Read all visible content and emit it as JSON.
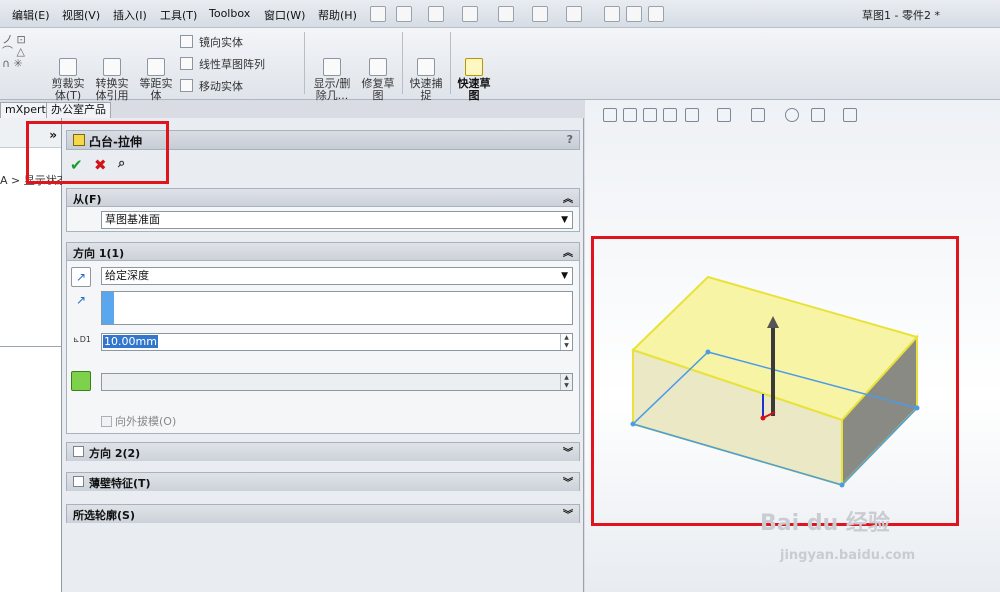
{
  "menubar": {
    "items": [
      "编辑(E)",
      "视图(V)",
      "插入(I)",
      "工具(T)",
      "Toolbox",
      "窗口(W)",
      "帮助(H)"
    ],
    "document_title": "草图1 - 零件2 *"
  },
  "ribbon": {
    "trim_entities": "剪裁实\n体(T)",
    "convert_entities": "转换实\n体引用",
    "offset_entities": "等距实\n体",
    "mirror_entities": "镜向实体",
    "linear_pattern": "线性草图阵列",
    "move_entities": "移动实体",
    "show_delete_relations": "显示/删\n除几...",
    "repair_sketch": "修复草\n图",
    "quick_snaps": "快速捕\n捉",
    "rapid_sketch": "快速草\n图"
  },
  "tabs": [
    "mXpert",
    "办公室产品"
  ],
  "left_panel": {
    "expand_symbol": "»",
    "tree_text": "A > 显示状态"
  },
  "property_manager": {
    "title": "凸台-拉伸",
    "help": "?",
    "ok_symbol": "✔",
    "cancel_symbol": "✖",
    "preview_symbol": "⌕",
    "from": {
      "header": "从(F)",
      "start_condition": "草图基准面"
    },
    "direction1": {
      "header": "方向 1(1)",
      "end_condition": "给定深度",
      "depth": "10.00mm",
      "depth_label": "D1",
      "draft_outward": "向外拔模(O)"
    },
    "direction2": {
      "header": "方向 2(2)"
    },
    "thin_feature": {
      "header": "薄壁特征(T)"
    },
    "selected_contours": {
      "header": "所选轮廓(S)"
    }
  },
  "watermark": {
    "logo": "Bai du 经验",
    "url": "jingyan.baidu.com"
  },
  "colors": {
    "highlight_box": "#e0141c",
    "preview_fill": "#f6f2a0",
    "preview_edge": "#e8e23a",
    "sketch_edge": "#4a9be8"
  }
}
